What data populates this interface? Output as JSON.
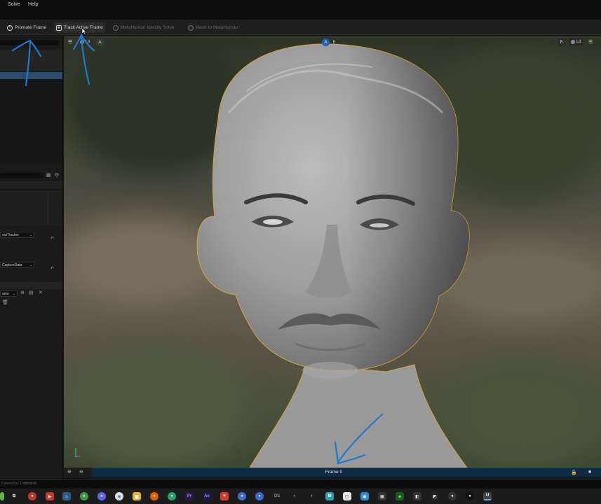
{
  "menu": {
    "items": [
      "Solve",
      "Help"
    ]
  },
  "toolbar": {
    "promote_frame": "Promote Frame",
    "track_active_frame": "Track Active Frame",
    "identity_solve": "MetaHuman Identity Solve",
    "mesh_to_metahuman": "Mesh to MetaHuman"
  },
  "left_panel": {
    "tracker_value": "ourTracker",
    "capture_value": "CaptureData",
    "frame_value": "ame"
  },
  "viewport": {
    "lit_left": "Lit",
    "badge_a_left": "A",
    "badge_a_center": "A",
    "badge_b_center": "B",
    "badge_b_right": "B",
    "lit_right": "Lit"
  },
  "timeline": {
    "frame_label": "Frame 0"
  },
  "console": {
    "placeholder": "Console Command"
  },
  "taskbar": {
    "apps": [
      "Pr",
      "Ae",
      "DS",
      "M"
    ]
  },
  "colors": {
    "accent_blue": "#1f62b0",
    "timeline_bg": "#0f2a45",
    "outline_orange": "#d9a441",
    "annotation_blue": "#1e78d0"
  }
}
